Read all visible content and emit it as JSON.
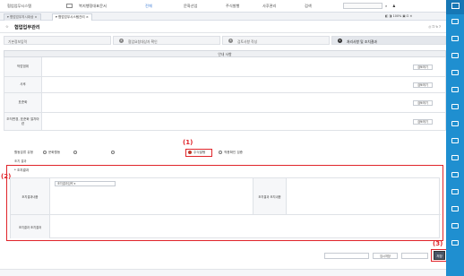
{
  "colors": {
    "accent": "#1f8fd0",
    "highlight": "#e0242a",
    "save": "#4a5566"
  },
  "topbar": {
    "menu": [
      "협업업무시스템",
      "",
      "복지행정대표문서",
      "",
      "전체",
      "",
      "문화산업",
      "",
      "주식발행",
      "",
      "사후관리",
      "",
      "검색"
    ],
    "search_placeholder": "",
    "right_labels": [
      "",
      "",
      ""
    ]
  },
  "tabs": [
    {
      "label": "▾  협업업무지시대상 ×"
    },
    {
      "label": "▾  협업업무시스템관리 ×"
    }
  ],
  "page": {
    "title": "협업업무관리",
    "subtitle": "",
    "breadcrumb": "",
    "tool_icons": [
      "print-icon",
      "bookmark-icon",
      "refresh-icon",
      "help-icon"
    ]
  },
  "steps": [
    {
      "num": "1",
      "label": "기본정보입력"
    },
    {
      "num": "2",
      "label": "협업요청대상자 확인"
    },
    {
      "num": "3",
      "label": "검토사항 작성"
    },
    {
      "num": "4",
      "label": "처리사항 및 조치결과"
    }
  ],
  "section_title": "안내 사항",
  "rows": [
    {
      "label": "작업범위",
      "text": "",
      "button": "검토하기"
    },
    {
      "label": "사후",
      "text": "",
      "button": "검토하기"
    },
    {
      "label": "표준화",
      "text": "",
      "button": "검토하기"
    },
    {
      "label": "조직변경, 표준화 절차마련",
      "text": "",
      "button": "검토하기"
    }
  ],
  "radio_row": {
    "label": "활동분류 유형",
    "options": [
      "문화활동",
      "",
      "",
      "주식발행",
      "적용확인 검증"
    ],
    "selected_index": 3
  },
  "sub_row": {
    "label": "조치 결과",
    "options": [
      "",
      ""
    ]
  },
  "callouts": {
    "one": "(1)",
    "two": "(2)",
    "three": "(3)"
  },
  "detail": {
    "req_label": "* 조치결과",
    "headline": "",
    "sub_info": "",
    "field_label_1": "조치결과내용",
    "field_value": "조치결과입력 ▾",
    "field_label_2": "조치결과 조치내용",
    "field_label_3": "조치결과 조치결과"
  },
  "bottom": {
    "buttons": [
      "",
      "임시저장",
      ""
    ],
    "save_label": "저장"
  },
  "rightbar": {
    "items": [
      "",
      "",
      "",
      "",
      "",
      "",
      "",
      "",
      "",
      "",
      "",
      "",
      "",
      ""
    ]
  }
}
